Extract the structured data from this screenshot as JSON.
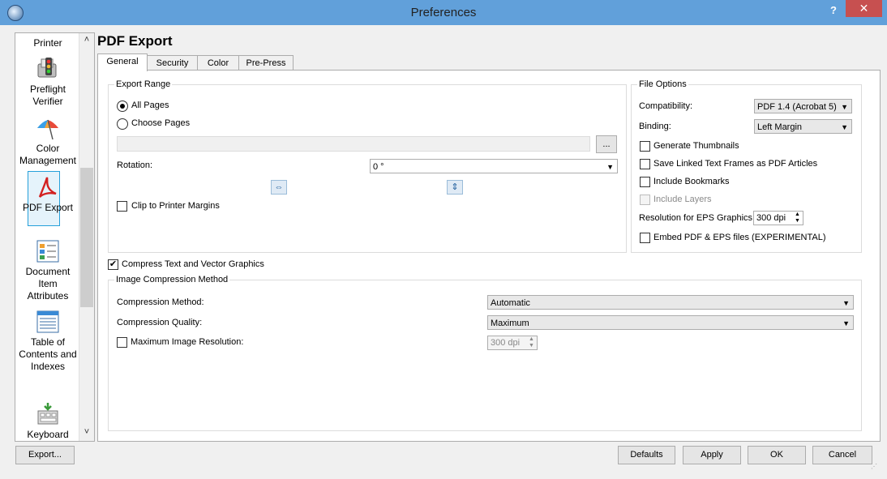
{
  "window": {
    "title": "Preferences",
    "help_label": "?",
    "close_label": "✕"
  },
  "sidebar": {
    "items": [
      {
        "label": "Printer",
        "icon": "printer-icon"
      },
      {
        "label": "Preflight Verifier",
        "icon": "traffic-light-icon"
      },
      {
        "label": "Color Management",
        "icon": "umbrella-icon"
      },
      {
        "label": "PDF Export",
        "icon": "pdf-icon",
        "selected": true
      },
      {
        "label": "Document Item Attributes",
        "icon": "attributes-icon"
      },
      {
        "label": "Table of Contents and Indexes",
        "icon": "toc-icon"
      },
      {
        "label": "Keyboard Shortcuts",
        "icon": "keyboard-icon"
      }
    ],
    "scroll_up": "˄",
    "scroll_down": "˅"
  },
  "page": {
    "title": "PDF Export"
  },
  "tabs": [
    {
      "label": "General",
      "active": true
    },
    {
      "label": "Security"
    },
    {
      "label": "Color"
    },
    {
      "label": "Pre-Press"
    }
  ],
  "export_range": {
    "title": "Export Range",
    "all_pages": "All Pages",
    "choose_pages": "Choose Pages",
    "browse_label": "...",
    "rotation_label": "Rotation:",
    "rotation_value": "0 °",
    "clip_label": "Clip to Printer Margins"
  },
  "file_options": {
    "title": "File Options",
    "compatibility_label": "Compatibility:",
    "compatibility_value": "PDF 1.4 (Acrobat 5)",
    "binding_label": "Binding:",
    "binding_value": "Left Margin",
    "generate_thumbnails": "Generate Thumbnails",
    "save_linked": "Save Linked Text Frames as PDF Articles",
    "include_bookmarks": "Include Bookmarks",
    "include_layers": "Include Layers",
    "resolution_label": "Resolution for EPS Graphics:",
    "resolution_value": "300 dpi",
    "embed_label": "Embed PDF & EPS files (EXPERIMENTAL)"
  },
  "compress": {
    "label": "Compress Text and Vector Graphics",
    "checked": true
  },
  "image_compression": {
    "title": "Image Compression Method",
    "method_label": "Compression Method:",
    "method_value": "Automatic",
    "quality_label": "Compression Quality:",
    "quality_value": "Maximum",
    "max_res_label": "Maximum Image Resolution:",
    "max_res_value": "300 dpi"
  },
  "footer": {
    "export": "Export...",
    "defaults": "Defaults",
    "apply": "Apply",
    "ok": "OK",
    "cancel": "Cancel"
  }
}
